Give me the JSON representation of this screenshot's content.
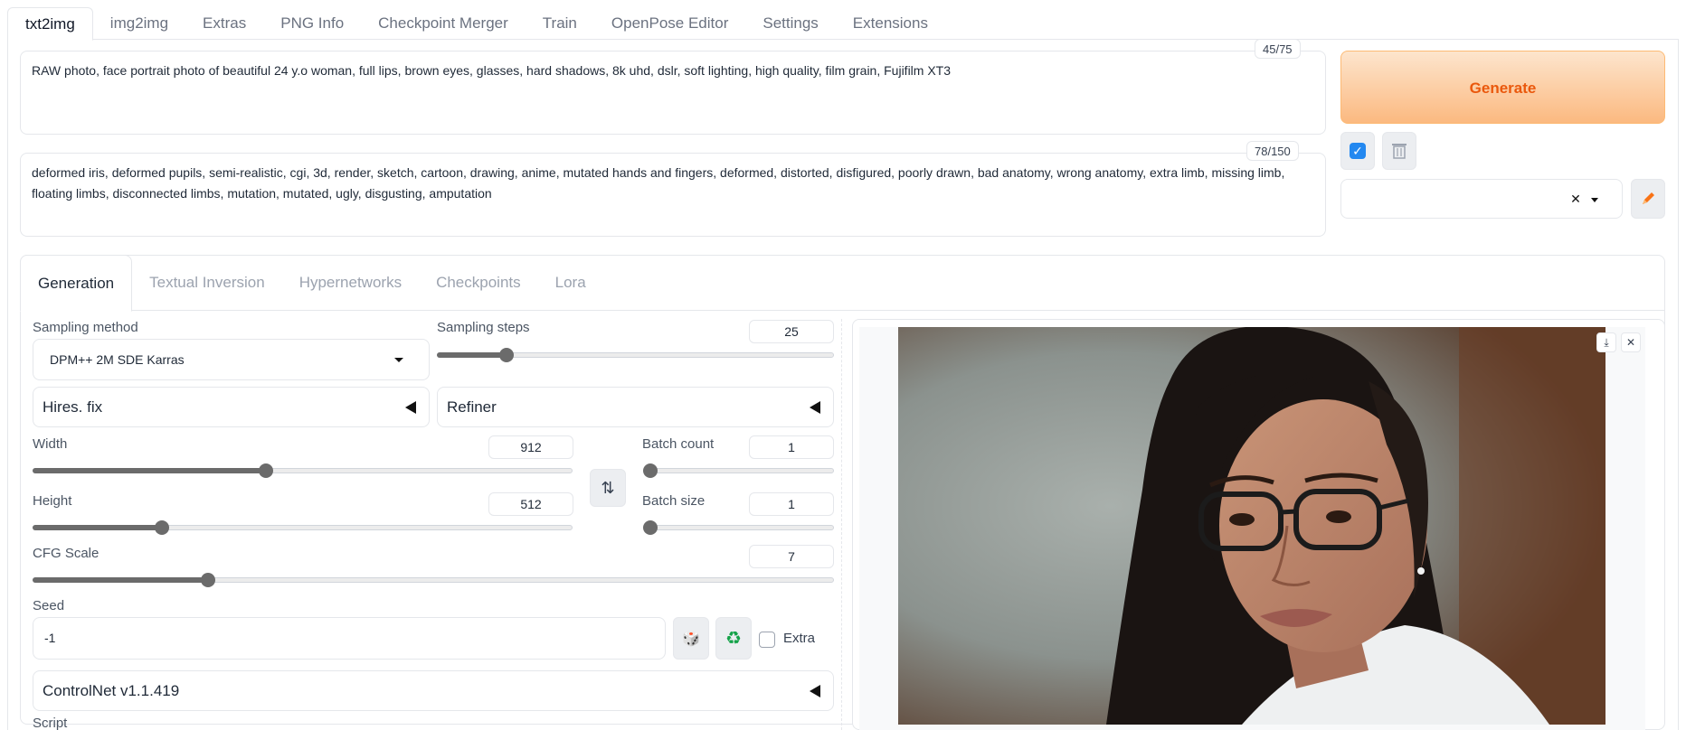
{
  "top_tabs": [
    "txt2img",
    "img2img",
    "Extras",
    "PNG Info",
    "Checkpoint Merger",
    "Train",
    "OpenPose Editor",
    "Settings",
    "Extensions"
  ],
  "prompt": {
    "text": "RAW photo, face portrait photo of beautiful 24 y.o woman, full lips, brown eyes, glasses, hard shadows, 8k uhd, dslr, soft lighting, high quality, film grain, Fujifilm XT3",
    "counter": "45/75"
  },
  "negative_prompt": {
    "text": "deformed iris, deformed pupils, semi-realistic, cgi, 3d, render, sketch, cartoon, drawing, anime, mutated hands and fingers, deformed, distorted, disfigured, poorly drawn, bad anatomy, wrong anatomy, extra limb, missing limb, floating limbs, disconnected limbs, mutation, mutated, ugly, disgusting, amputation",
    "counter": "78/150"
  },
  "generate_label": "Generate",
  "sub_tabs": [
    "Generation",
    "Textual Inversion",
    "Hypernetworks",
    "Checkpoints",
    "Lora"
  ],
  "sampling_method": {
    "label": "Sampling method",
    "value": "DPM++ 2M SDE Karras"
  },
  "sampling_steps": {
    "label": "Sampling steps",
    "value": "25",
    "fraction": 0.163
  },
  "hires_fix": {
    "label": "Hires. fix"
  },
  "refiner": {
    "label": "Refiner"
  },
  "width": {
    "label": "Width",
    "value": "912",
    "fraction": 0.43
  },
  "height": {
    "label": "Height",
    "value": "512",
    "fraction": 0.233
  },
  "batch_count": {
    "label": "Batch count",
    "value": "1",
    "fraction": 0.0
  },
  "batch_size": {
    "label": "Batch size",
    "value": "1",
    "fraction": 0.0
  },
  "cfg_scale": {
    "label": "CFG Scale",
    "value": "7",
    "fraction": 0.214
  },
  "seed": {
    "label": "Seed",
    "value": "-1",
    "extra_label": "Extra"
  },
  "controlnet": {
    "label": "ControlNet v1.1.419"
  },
  "script": {
    "label": "Script"
  },
  "icons": {
    "swap": "swap-dimensions-icon",
    "dice": "dice-icon",
    "recycle": "recycle-icon",
    "trash": "trash-icon",
    "pencil": "pencil-icon",
    "download": "download-icon",
    "close": "close-icon"
  },
  "colors": {
    "generate_text": "#ea580c",
    "generate_bg_top": "#fde5cd",
    "generate_bg_bottom": "#fbb980",
    "checkbox_blue": "#2388f0",
    "slider_fill": "#6b6b6b"
  }
}
